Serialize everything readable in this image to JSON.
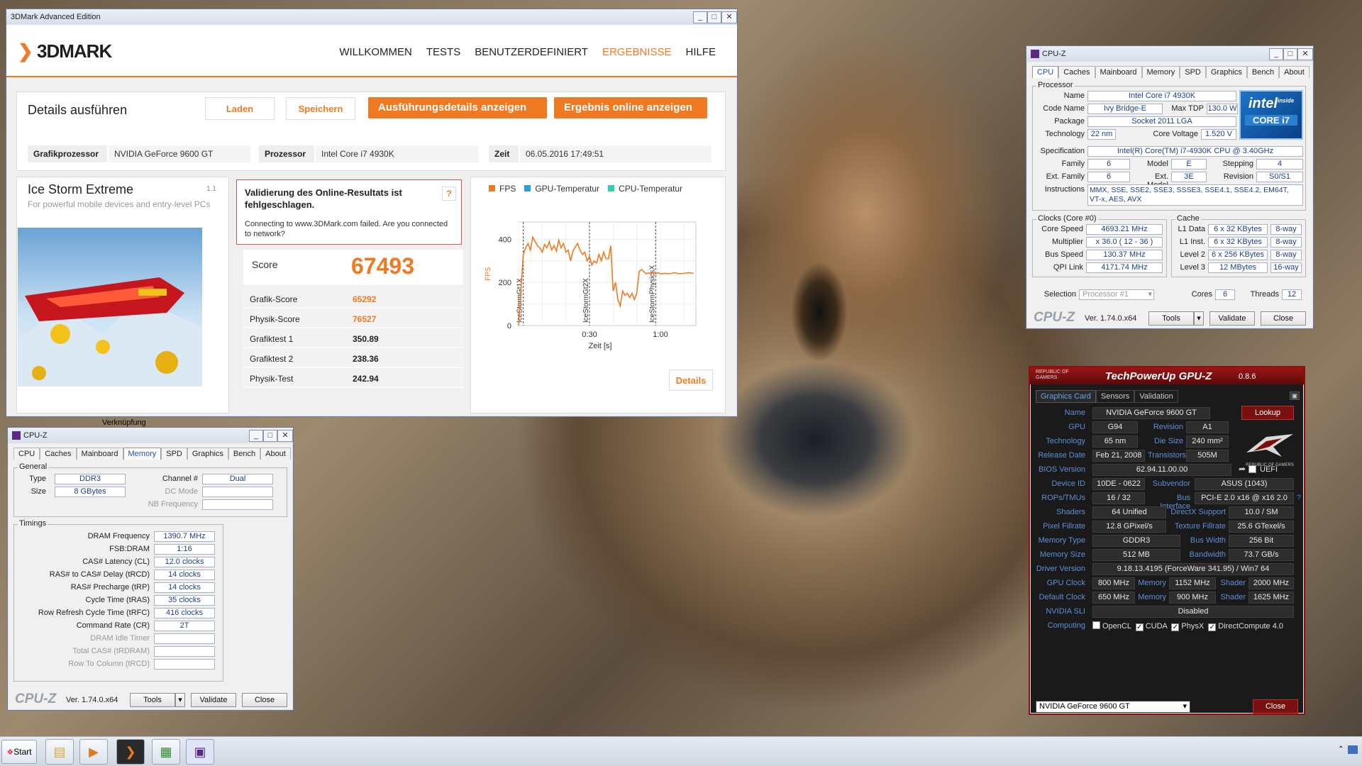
{
  "mark": {
    "window_title": "3DMark Advanced Edition",
    "logo": "3DMARK",
    "nav": [
      "WILLKOMMEN",
      "TESTS",
      "BENUTZERDEFINIERT",
      "ERGEBNISSE",
      "HILFE"
    ],
    "details_title": "Details ausführen",
    "load": "Laden",
    "save": "Speichern",
    "show_details": "Ausführungsdetails anzeigen",
    "show_online": "Ergebnis online anzeigen",
    "gpu_label": "Grafikprozessor",
    "gpu_value": "NVIDIA GeForce 9600 GT",
    "cpu_label": "Prozessor",
    "cpu_value": "Intel Core i7 4930K",
    "time_label": "Zeit",
    "time_value": "06.05.2016 17:49:51",
    "test_name": "Ice Storm Extreme",
    "test_version": "1.1",
    "test_desc": "For powerful mobile devices and entry-level PCs",
    "validation_title": "Validierung des Online-Resultats ist fehlgeschlagen.",
    "validation_msg": "Connecting to www.3DMark.com failed. Are you connected to network?",
    "score_label": "Score",
    "score_value": "67493",
    "rows": [
      {
        "label": "Grafik-Score",
        "value": "65292"
      },
      {
        "label": "Physik-Score",
        "value": "76527"
      },
      {
        "label": "Grafiktest 1",
        "value": "350.89"
      },
      {
        "label": "Grafiktest 2",
        "value": "238.36"
      },
      {
        "label": "Physik-Test",
        "value": "242.94"
      }
    ],
    "legend": [
      "FPS",
      "GPU-Temperatur",
      "CPU-Temperatur"
    ],
    "details_btn": "Details",
    "below_label": "Verknüpfung"
  },
  "chart_data": {
    "type": "line",
    "xlabel": "Zeit [s]",
    "ylabel": "FPS",
    "x_ticks": [
      "0:30",
      "1:00"
    ],
    "y_ticks": [
      "0",
      "200",
      "400"
    ],
    "ylim": [
      0,
      480
    ],
    "xlim": [
      0,
      75
    ],
    "markers": [
      {
        "x": 2,
        "label": "IceStormGt1X"
      },
      {
        "x": 30,
        "label": "IceStormGt2X"
      },
      {
        "x": 58,
        "label": "IceStormPhysicsX"
      }
    ],
    "series": [
      {
        "name": "FPS",
        "color": "#f07a22",
        "x": [
          0,
          2,
          3,
          4,
          5,
          6,
          7,
          8,
          9,
          10,
          11,
          12,
          13,
          14,
          15,
          16,
          17,
          18,
          19,
          20,
          21,
          22,
          23,
          24,
          25,
          26,
          27,
          28,
          29,
          30,
          31,
          32,
          33,
          34,
          35,
          36,
          37,
          38,
          39,
          40,
          41,
          42,
          43,
          44,
          45,
          46,
          47,
          48,
          49,
          50,
          51,
          52,
          53,
          54,
          55,
          56,
          57,
          58,
          59,
          60,
          62,
          64,
          66,
          68,
          70,
          72,
          74
        ],
        "y": [
          0,
          330,
          360,
          380,
          350,
          410,
          390,
          370,
          360,
          340,
          375,
          360,
          390,
          350,
          370,
          345,
          395,
          360,
          380,
          340,
          350,
          300,
          345,
          365,
          380,
          350,
          330,
          340,
          300,
          320,
          280,
          300,
          290,
          330,
          300,
          340,
          310,
          310,
          370,
          160,
          200,
          120,
          90,
          160,
          140,
          150,
          130,
          150,
          120,
          150,
          250,
          260,
          250,
          240,
          245,
          240,
          245,
          240,
          245,
          240,
          242,
          240,
          245,
          240,
          242,
          245,
          242
        ]
      }
    ]
  },
  "cpuz1": {
    "title": "CPU-Z",
    "tabs": [
      "CPU",
      "Caches",
      "Mainboard",
      "Memory",
      "SPD",
      "Graphics",
      "Bench",
      "About"
    ],
    "processor": "Processor",
    "name_l": "Name",
    "name": "Intel Core i7 4930K",
    "code_l": "Code Name",
    "code": "Ivy Bridge-E",
    "tdp_l": "Max TDP",
    "tdp": "130.0 W",
    "pkg_l": "Package",
    "pkg": "Socket 2011 LGA",
    "tech_l": "Technology",
    "tech": "22 nm",
    "volt_l": "Core Voltage",
    "volt": "1.520 V",
    "spec_l": "Specification",
    "spec": "Intel(R) Core(TM) i7-4930K CPU @ 3.40GHz",
    "fam_l": "Family",
    "fam": "6",
    "model_l": "Model",
    "model": "E",
    "step_l": "Stepping",
    "step": "4",
    "efam_l": "Ext. Family",
    "efam": "6",
    "emodel_l": "Ext. Model",
    "emodel": "3E",
    "rev_l": "Revision",
    "rev": "S0/S1",
    "instr_l": "Instructions",
    "instr": "MMX, SSE, SSE2, SSE3, SSSE3, SSE4.1, SSE4.2, EM64T, VT-x, AES, AVX",
    "clocks": "Clocks (Core #0)",
    "cspeed_l": "Core Speed",
    "cspeed": "4693.21 MHz",
    "mult_l": "Multiplier",
    "mult": "x 36.0 ( 12 - 36 )",
    "bus_l": "Bus Speed",
    "bus": "130.37 MHz",
    "qpi_l": "QPI Link",
    "qpi": "4171.74 MHz",
    "cache": "Cache",
    "l1d_l": "L1 Data",
    "l1d": "6 x 32 KBytes",
    "l1d_w": "8-way",
    "l1i_l": "L1 Inst.",
    "l1i": "6 x 32 KBytes",
    "l1i_w": "8-way",
    "l2_l": "Level 2",
    "l2": "6 x 256 KBytes",
    "l2_w": "8-way",
    "l3_l": "Level 3",
    "l3": "12 MBytes",
    "l3_w": "16-way",
    "sel_l": "Selection",
    "sel": "Processor #1",
    "cores_l": "Cores",
    "cores": "6",
    "threads_l": "Threads",
    "threads": "12",
    "ver": "Ver. 1.74.0.x64",
    "tools": "Tools",
    "validate": "Validate",
    "close": "Close",
    "logo": "CPU-Z",
    "intel_top": "intel",
    "intel_inside": "inside",
    "intel_bottom": "CORE i7"
  },
  "cpuz2": {
    "title": "CPU-Z",
    "general": "General",
    "type_l": "Type",
    "type": "DDR3",
    "chan_l": "Channel #",
    "chan": "Dual",
    "size_l": "Size",
    "size": "8 GBytes",
    "dc_l": "DC Mode",
    "nb_l": "NB Frequency",
    "timings": "Timings",
    "t": [
      {
        "l": "DRAM Frequency",
        "v": "1390.7 MHz"
      },
      {
        "l": "FSB:DRAM",
        "v": "1:16"
      },
      {
        "l": "CAS# Latency (CL)",
        "v": "12.0 clocks"
      },
      {
        "l": "RAS# to CAS# Delay (tRCD)",
        "v": "14 clocks"
      },
      {
        "l": "RAS# Precharge (tRP)",
        "v": "14 clocks"
      },
      {
        "l": "Cycle Time (tRAS)",
        "v": "35 clocks"
      },
      {
        "l": "Row Refresh Cycle Time (tRFC)",
        "v": "416 clocks"
      },
      {
        "l": "Command Rate (CR)",
        "v": "2T"
      },
      {
        "l": "DRAM Idle Timer",
        "v": ""
      },
      {
        "l": "Total CAS# (tRDRAM)",
        "v": ""
      },
      {
        "l": "Row To Column (tRCD)",
        "v": ""
      }
    ]
  },
  "gpuz": {
    "brand": "REPUBLIC OF GAMERS",
    "title": "TechPowerUp GPU-Z",
    "ver": "0.8.6",
    "tabs": [
      "Graphics Card",
      "Sensors",
      "Validation"
    ],
    "name_l": "Name",
    "name": "NVIDIA GeForce 9600 GT",
    "lookup": "Lookup",
    "gpu_l": "GPU",
    "gpu": "G94",
    "rev_l": "Revision",
    "rev": "A1",
    "tech_l": "Technology",
    "tech": "65 nm",
    "die_l": "Die Size",
    "die": "240 mm²",
    "rel_l": "Release Date",
    "rel": "Feb 21, 2008",
    "trans_l": "Transistors",
    "trans": "505M",
    "bios_l": "BIOS Version",
    "bios": "62.94.11.00.00",
    "uefi": "UEFI",
    "dev_l": "Device ID",
    "dev": "10DE - 0622",
    "sub_l": "Subvendor",
    "sub": "ASUS (1043)",
    "rops_l": "ROPs/TMUs",
    "rops": "16 / 32",
    "busif_l": "Bus Interface",
    "busif": "PCI-E 2.0 x16 @ x16 2.0",
    "shad_l": "Shaders",
    "shad": "64 Unified",
    "dx_l": "DirectX Support",
    "dx": "10.0 / SM",
    "pix_l": "Pixel Fillrate",
    "pix": "12.8 GPixel/s",
    "tex_l": "Texture Fillrate",
    "tex": "25.6 GTexel/s",
    "mtype_l": "Memory Type",
    "mtype": "GDDR3",
    "bw_l": "Bus Width",
    "bw": "256 Bit",
    "msize_l": "Memory Size",
    "msize": "512 MB",
    "band_l": "Bandwidth",
    "band": "73.7 GB/s",
    "drv_l": "Driver Version",
    "drv": "9.18.13.4195 (ForceWare 341.95) / Win7 64",
    "gclk_l": "GPU Clock",
    "gclk": "800 MHz",
    "mem_l": "Memory",
    "gmem": "1152 MHz",
    "shd_l": "Shader",
    "gshd": "2000 MHz",
    "dclk_l": "Default Clock",
    "dclk": "650 MHz",
    "dmem": "900 MHz",
    "dshd": "1625 MHz",
    "sli_l": "NVIDIA SLI",
    "sli": "Disabled",
    "comp_l": "Computing",
    "opencl": "OpenCL",
    "cuda": "CUDA",
    "physx": "PhysX",
    "dc": "DirectCompute 4.0",
    "select": "NVIDIA GeForce 9600 GT",
    "close": "Close",
    "rog": "REPUBLIC OF GAMERS"
  },
  "taskbar": {
    "start": "Start"
  }
}
